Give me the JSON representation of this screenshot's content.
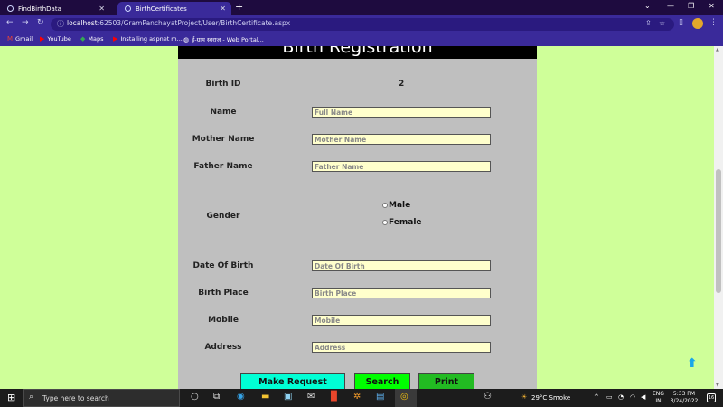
{
  "browser": {
    "tabs": [
      {
        "label": "FindBirthData",
        "active": false
      },
      {
        "label": "BirthCertificates",
        "active": true
      }
    ],
    "url_host": "localhost",
    "url_path": ":62503/GramPanchayatProject/User/BirthCertificate.aspx",
    "bookmarks": [
      "Gmail",
      "YouTube",
      "Maps",
      "Installing aspnet m...",
      "ई-ग्राम स्वराज - Web Portal..."
    ]
  },
  "page": {
    "header": "Birth Registration",
    "birth_id_label": "Birth ID",
    "birth_id_value": "2",
    "fields": {
      "name": {
        "label": "Name",
        "placeholder": "Full Name"
      },
      "mother": {
        "label": "Mother Name",
        "placeholder": "Mother Name"
      },
      "father": {
        "label": "Father Name",
        "placeholder": "Father Name"
      },
      "dob": {
        "label": "Date Of Birth",
        "placeholder": "Date Of Birth"
      },
      "place": {
        "label": "Birth Place",
        "placeholder": "Birth Place"
      },
      "mobile": {
        "label": "Mobile",
        "placeholder": "Mobile"
      },
      "address": {
        "label": "Address",
        "placeholder": "Address"
      }
    },
    "gender": {
      "label": "Gender",
      "options": [
        "Male",
        "Female"
      ]
    },
    "buttons": {
      "request": "Make Request",
      "search": "Search",
      "print": "Print"
    }
  },
  "taskbar": {
    "search_placeholder": "Type here to search",
    "weather": "29°C  Smoke",
    "lang_line1": "ENG",
    "lang_line2": "IN",
    "time": "5:33 PM",
    "date": "3/24/2022",
    "notifications": "16"
  },
  "colors": {
    "page_bg": "#cfff99",
    "panel_bg": "#bfbfbf",
    "input_bg": "#ffffcc",
    "make_request": "#00ffd5",
    "search": "#00ff00",
    "print": "#22bb22"
  }
}
